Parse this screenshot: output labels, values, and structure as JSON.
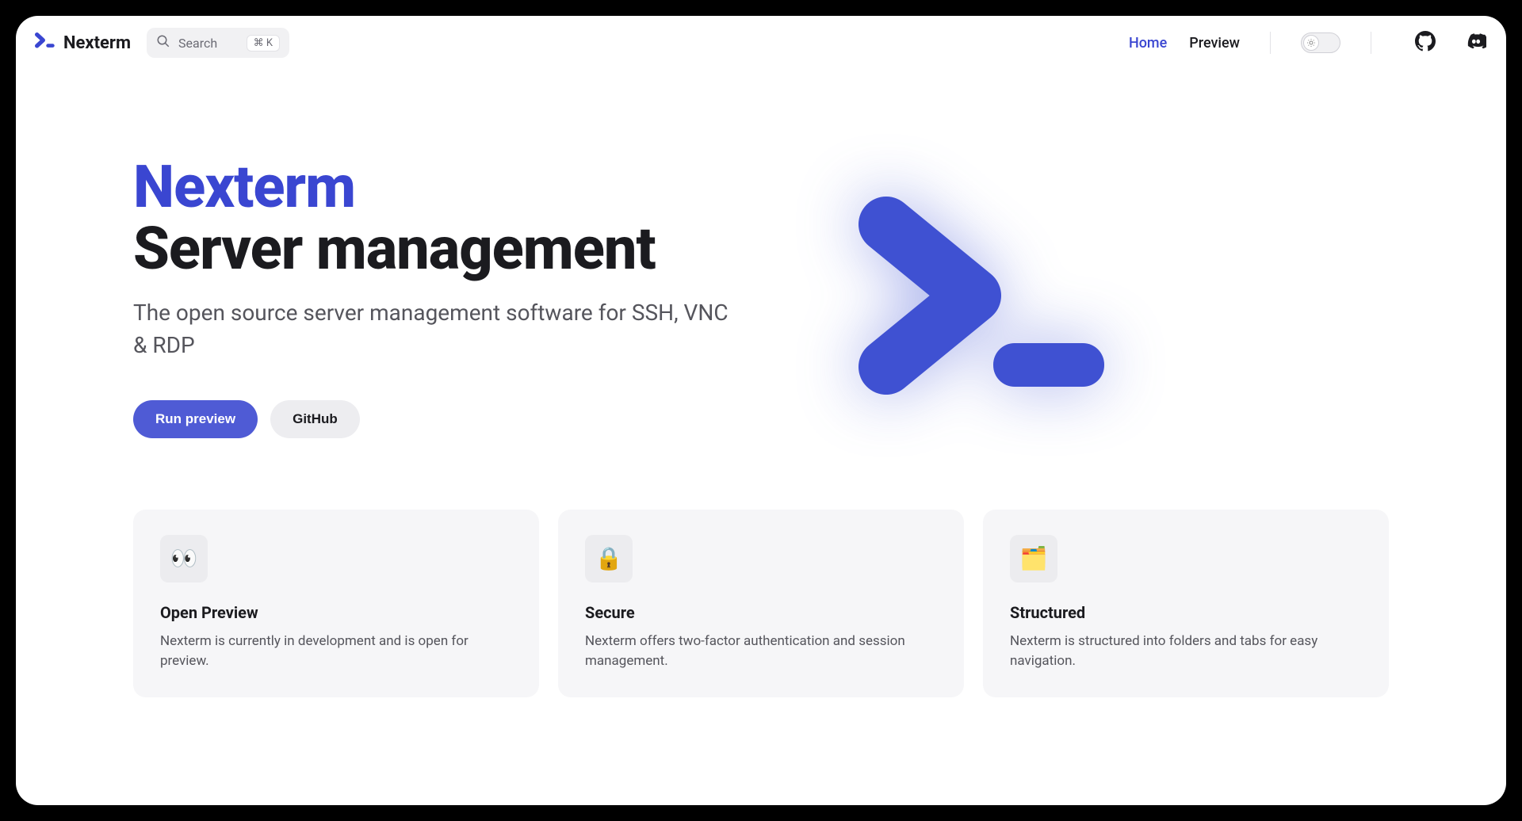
{
  "brand": {
    "name": "Nexterm"
  },
  "search": {
    "placeholder": "Search",
    "kbd": "⌘ K"
  },
  "nav": {
    "home": "Home",
    "preview": "Preview"
  },
  "hero": {
    "title_accent": "Nexterm",
    "title": "Server management",
    "subtitle": "The open source server management software for SSH, VNC & RDP",
    "btn_primary": "Run preview",
    "btn_secondary": "GitHub"
  },
  "features": [
    {
      "icon": "👀",
      "title": "Open Preview",
      "desc": "Nexterm is currently in development and is open for preview."
    },
    {
      "icon": "🔒",
      "title": "Secure",
      "desc": "Nexterm offers two-factor authentication and session management."
    },
    {
      "icon": "🗂️",
      "title": "Structured",
      "desc": "Nexterm is structured into folders and tabs for easy navigation."
    }
  ],
  "colors": {
    "accent": "#3a46d1",
    "primary_btn": "#4f5bd5"
  }
}
